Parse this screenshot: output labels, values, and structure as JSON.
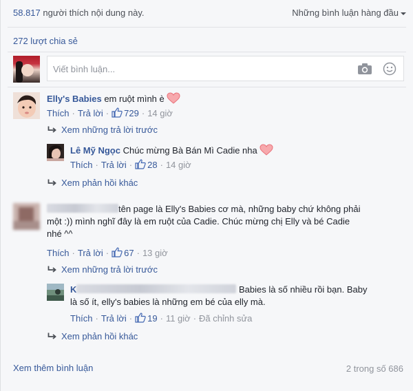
{
  "summary": {
    "like_count": "58.817",
    "like_text": "người thích nội dung này.",
    "sort_label": "Những bình luận hàng đầu",
    "shares": "272 lượt chia sẻ"
  },
  "composer": {
    "placeholder": "Viết bình luận...",
    "camera_icon": "camera-icon",
    "emoji_icon": "smiley-icon"
  },
  "comments": [
    {
      "author": "Elly's Babies",
      "text": "em ruột mình è",
      "emoji": "heart-icon",
      "like_label": "Thích",
      "reply_label": "Trả lời",
      "likes": "729",
      "time": "14 giờ",
      "prev_replies": "Xem những trả lời trước",
      "reply": {
        "author": "Lê Mỹ Ngọc",
        "text": "Chúc mừng Bà Bán Mì Cadie nha",
        "emoji": "heart-icon",
        "like_label": "Thích",
        "reply_label": "Trả lời",
        "likes": "28",
        "time": "14 giờ"
      },
      "more_replies": "Xem phản hồi khác"
    },
    {
      "text_line1": "tên page là Elly's Babies cơ mà, những baby chứ không phải",
      "text_line2": "một :)) mình nghĩ đây là em ruột của Cadie. Chúc mừng chị Elly và bé Cadie",
      "text_line3": "nhé ^^",
      "like_label": "Thích",
      "reply_label": "Trả lời",
      "likes": "67",
      "time": "13 giờ",
      "prev_replies": "Xem những trả lời trước",
      "reply": {
        "text_line1": "Babies là số nhiều rồi bạn. Baby",
        "text_line2": "là số ít, elly's babies là những em bé của elly mà.",
        "like_label": "Thích",
        "reply_label": "Trả lời",
        "likes": "19",
        "time": "11 giờ",
        "edited": "Đã chỉnh sửa"
      },
      "more_replies": "Xem phản hồi khác"
    }
  ],
  "footer": {
    "more_comments": "Xem thêm bình luận",
    "count": "2 trong số 686"
  },
  "colors": {
    "link": "#365899",
    "muted": "#90949c",
    "background": "#f6f7f9",
    "heart": "#f1797f"
  }
}
